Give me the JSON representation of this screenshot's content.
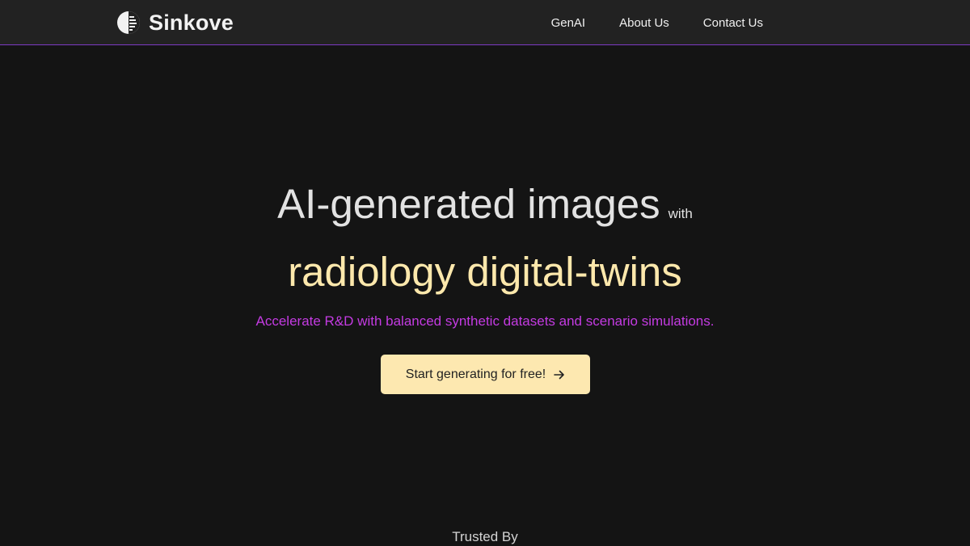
{
  "brand": {
    "name": "Sinkove"
  },
  "nav": {
    "items": [
      {
        "label": "GenAI"
      },
      {
        "label": "About Us"
      },
      {
        "label": "Contact Us"
      }
    ]
  },
  "hero": {
    "headline_main": "AI-generated images",
    "headline_connector": "with",
    "headline_highlight": "radiology digital-twins",
    "subtitle": "Accelerate R&D with balanced synthetic datasets and scenario simulations.",
    "cta_label": "Start generating for free!"
  },
  "trusted": {
    "label": "Trusted By"
  },
  "colors": {
    "background": "#141414",
    "navbar": "#222222",
    "accent_purple": "#c43be2",
    "highlight_yellow": "#fde8ac",
    "cta_background": "#fde8b0"
  },
  "icons": {
    "logo": "sinkove-logo-icon",
    "cta": "arrow-right-icon"
  }
}
